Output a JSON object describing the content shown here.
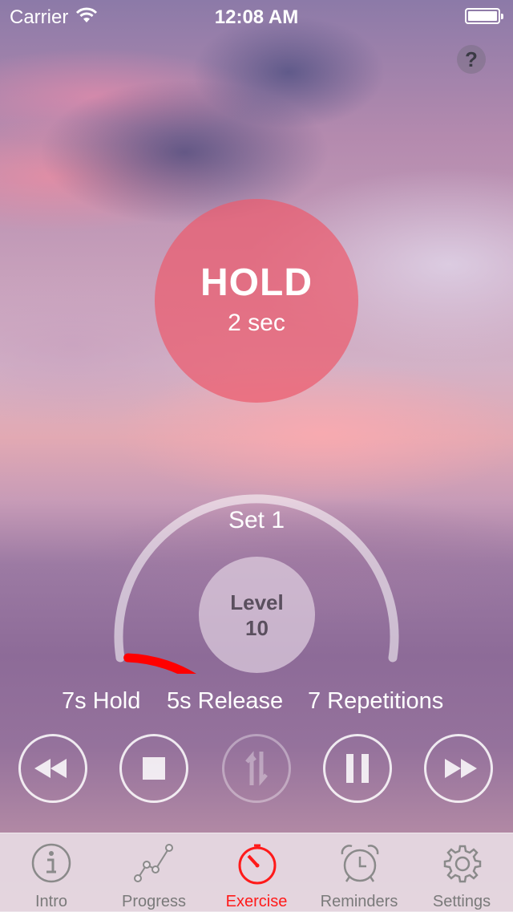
{
  "status_bar": {
    "carrier": "Carrier",
    "time": "12:08 AM"
  },
  "help_button": {
    "label": "?"
  },
  "exercise": {
    "phase": "HOLD",
    "phase_time": "2 sec",
    "set_label": "Set 1",
    "level_label": "Level",
    "level_value": "10",
    "progress_fraction": 0.3,
    "hold": "7s Hold",
    "release": "5s Release",
    "repetitions": "7 Repetitions"
  },
  "controls": [
    {
      "name": "rewind",
      "icon": "rewind-icon"
    },
    {
      "name": "stop",
      "icon": "stop-icon"
    },
    {
      "name": "swap",
      "icon": "swap-arrows-icon"
    },
    {
      "name": "pause",
      "icon": "pause-icon"
    },
    {
      "name": "fast-forward",
      "icon": "fast-forward-icon"
    }
  ],
  "tabs": [
    {
      "label": "Intro",
      "icon": "info-icon"
    },
    {
      "label": "Progress",
      "icon": "progress-graph-icon"
    },
    {
      "label": "Exercise",
      "icon": "stopwatch-icon",
      "active": true
    },
    {
      "label": "Reminders",
      "icon": "alarm-clock-icon"
    },
    {
      "label": "Settings",
      "icon": "gear-icon"
    }
  ],
  "colors": {
    "accent": "#ff0000",
    "hold_circle": "#ec5c6e",
    "tab_inactive": "#7a7a7a"
  }
}
